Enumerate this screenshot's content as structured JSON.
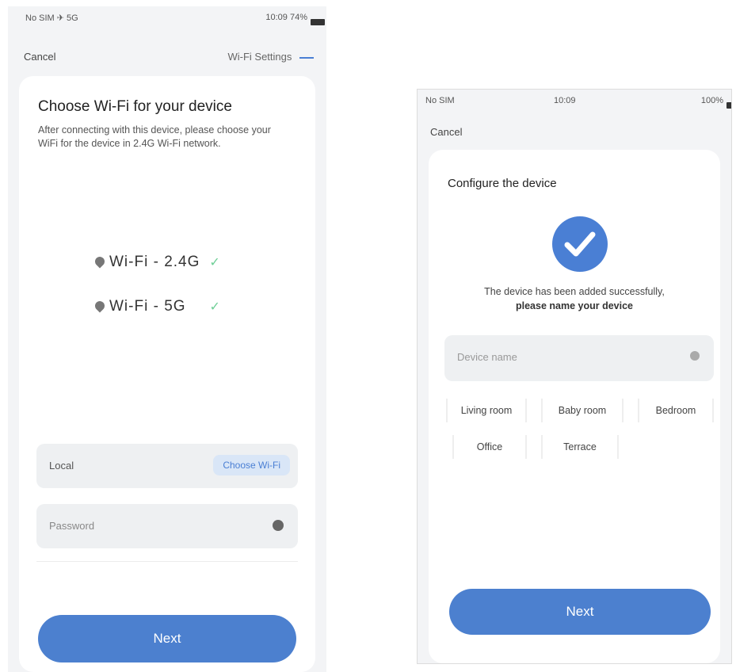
{
  "left_screen": {
    "status": {
      "left": "No SIM ✈ 5G",
      "right": "10:09 74%"
    },
    "nav": {
      "cancel": "Cancel",
      "right": "Wi-Fi Settings"
    },
    "title": "Choose Wi-Fi for your device",
    "description": "After connecting with this device, please choose your WiFi for the device in 2.4G Wi-Fi network.",
    "wifi_options": [
      {
        "label": "Wi-Fi - 2.4G",
        "check": "✓"
      },
      {
        "label": "Wi-Fi - 5G",
        "check": "✓"
      }
    ],
    "wifi_field": {
      "value": "Local",
      "action": "Choose Wi-Fi"
    },
    "password_field": {
      "placeholder": "Password"
    },
    "next_button": "Next"
  },
  "right_screen": {
    "status": {
      "left": "No SIM",
      "center": "10:09",
      "right": "100%"
    },
    "nav": {
      "cancel": "Cancel"
    },
    "title": "Configure the device",
    "success_line1": "The device has been added successfully,",
    "success_line2": "please name your device",
    "name_field": {
      "placeholder": "Device name"
    },
    "chips": [
      "Living room",
      "Baby room",
      "Bedroom",
      "Office",
      "Terrace"
    ],
    "next_button": "Next"
  },
  "colors": {
    "accent": "#4c80cf",
    "check": "#6fcf97",
    "field_bg": "#eef0f2"
  },
  "icons": [
    "wifi-icon",
    "check-icon",
    "eye-icon",
    "battery-icon",
    "success-check-icon"
  ]
}
